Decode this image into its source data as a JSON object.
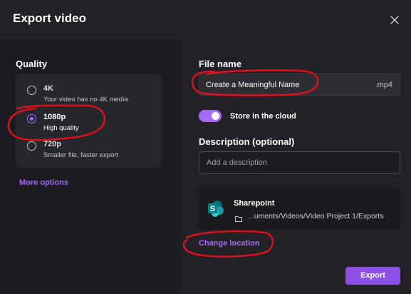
{
  "dialog": {
    "title": "Export video"
  },
  "quality": {
    "label": "Quality",
    "selected": "1080p",
    "options": [
      {
        "name": "4K",
        "description": "Your video has no 4K media"
      },
      {
        "name": "1080p",
        "description": "High quality"
      },
      {
        "name": "720p",
        "description": "Smaller file, faster export"
      }
    ],
    "more_options_label": "More options"
  },
  "file_name": {
    "label": "File name",
    "value": "Create a Meaningful Name",
    "extension": ".mp4"
  },
  "cloud": {
    "label": "Store in the cloud",
    "enabled": true
  },
  "description": {
    "label": "Description (optional)",
    "placeholder": "Add a description",
    "value": ""
  },
  "location": {
    "service": "Sharepoint",
    "path": "...uments/Videos/Video Project 1/Exports",
    "change_label": "Change location"
  },
  "actions": {
    "export_label": "Export"
  },
  "colors": {
    "accent": "#a46cf5",
    "button": "#8e4fe8",
    "annotation": "#e0101a",
    "sharepoint": "#038387"
  }
}
